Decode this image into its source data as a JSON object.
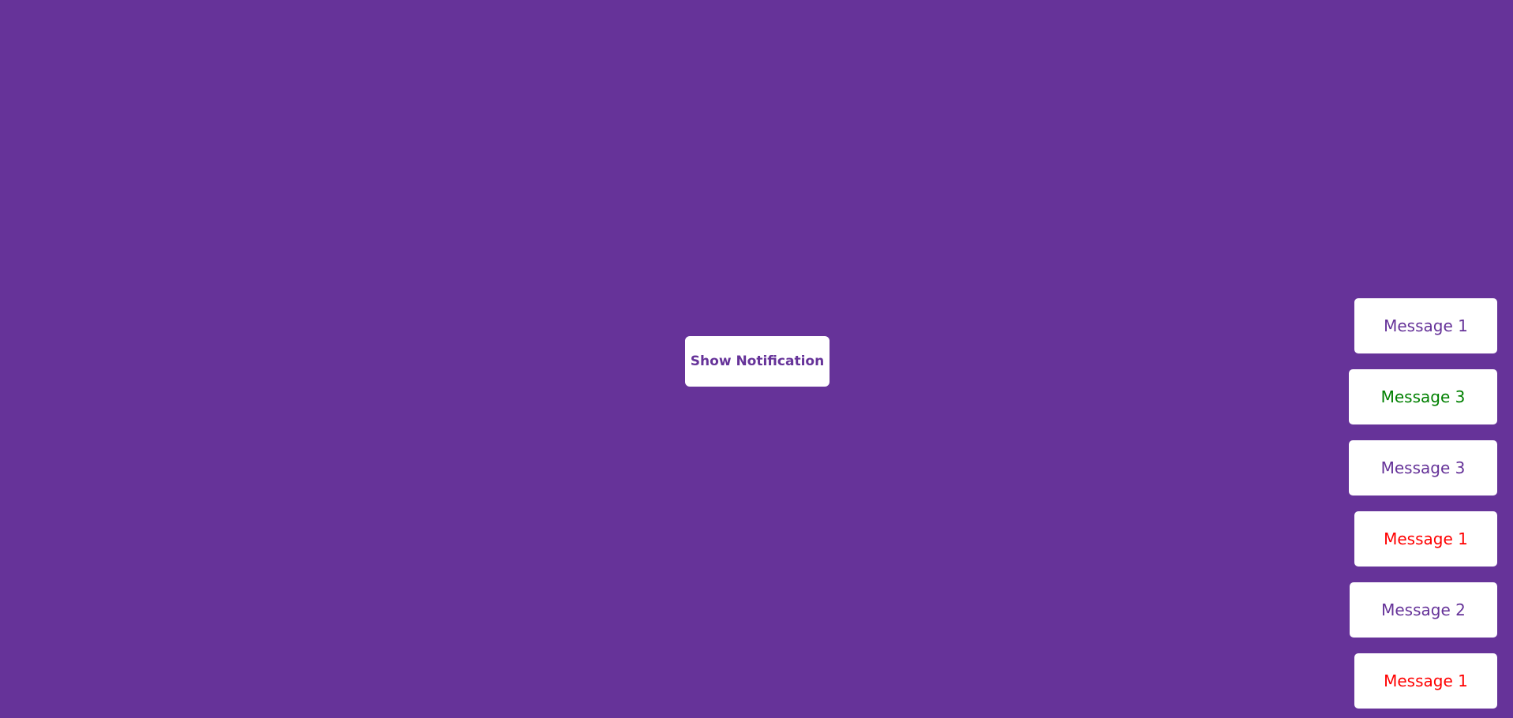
{
  "page": {
    "background_color": "#663399"
  },
  "button": {
    "label": "Show Notification",
    "text_color": "#663399"
  },
  "notifications": [
    {
      "text": "Message 1",
      "type": "info",
      "color": "#663399"
    },
    {
      "text": "Message 3",
      "type": "success",
      "color": "#008000"
    },
    {
      "text": "Message 3",
      "type": "info",
      "color": "#663399"
    },
    {
      "text": "Message 1",
      "type": "error",
      "color": "#ff0000"
    },
    {
      "text": "Message 2",
      "type": "info",
      "color": "#663399"
    },
    {
      "text": "Message 1",
      "type": "error",
      "color": "#ff0000"
    }
  ]
}
